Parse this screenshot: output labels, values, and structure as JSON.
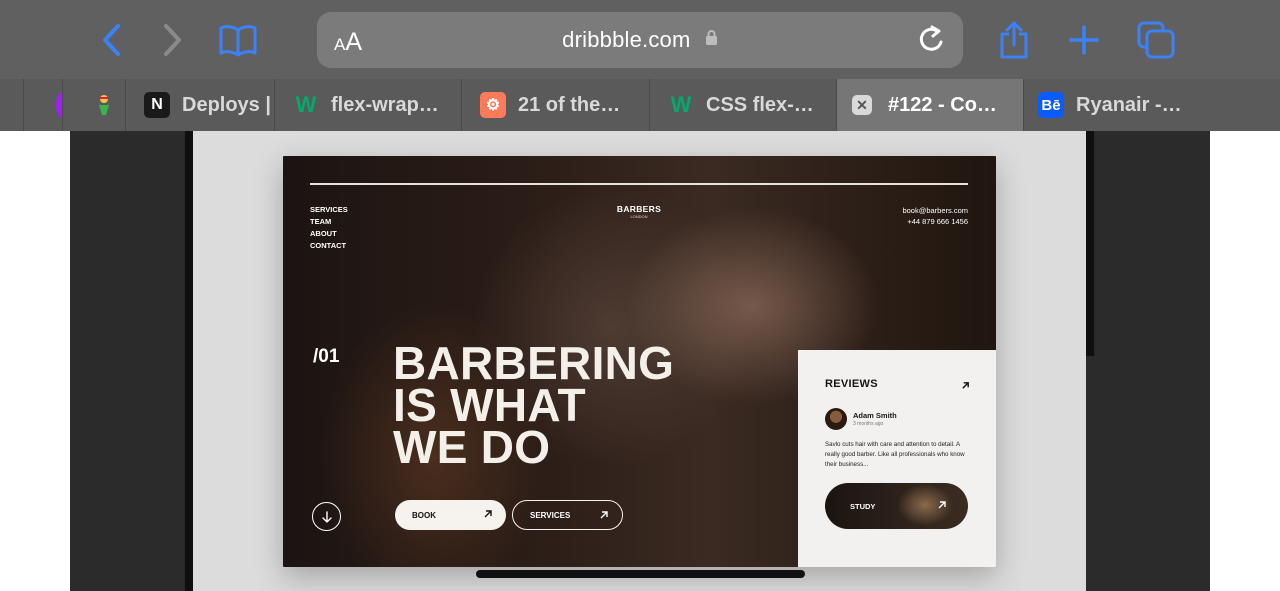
{
  "browser": {
    "address": {
      "aa_small": "A",
      "aa_large": "A",
      "url": "dribbble.com"
    }
  },
  "tabs": [
    {
      "label": "",
      "icon": "purple-circle-favicon",
      "color": "#a020f0"
    },
    {
      "label": "",
      "icon": "character-favicon",
      "color": "#3a3a3a"
    },
    {
      "label": "Deploys |",
      "icon": "notion-favicon",
      "favicon_text": "N",
      "color": "#ffffff"
    },
    {
      "label": "flex-wrap…",
      "icon": "w3schools-favicon",
      "favicon_text": "W",
      "color": "#04aa6d"
    },
    {
      "label": "21 of the…",
      "icon": "hubspot-favicon",
      "favicon_text": "⚙",
      "color": "#ff7a59"
    },
    {
      "label": "CSS flex-…",
      "icon": "w3schools-favicon",
      "favicon_text": "W",
      "color": "#04aa6d"
    },
    {
      "label": "#122 - Co…",
      "icon": "close-square-favicon",
      "favicon_text": "✕",
      "color": "#e0e0e0"
    },
    {
      "label": "Ryanair -…",
      "icon": "behance-favicon",
      "favicon_text": "Bē",
      "color": "#0b5cff"
    }
  ],
  "shot": {
    "nav": [
      "SERVICES",
      "TEAM",
      "ABOUT",
      "CONTACT"
    ],
    "logo_title": "BARBERS",
    "logo_sub": "LONDON",
    "email": "book@barbers.com",
    "phone": "+44 879 666 1456",
    "index": "/01",
    "hero_lines": [
      "BARBERING",
      "IS WHAT",
      "WE DO"
    ],
    "book_label": "BOOK",
    "services_label": "SERVICES",
    "reviews": {
      "title": "REVIEWS",
      "name": "Adam Smith",
      "ago": "3 months ago",
      "text": "Savlo cuts hair with care and attention to detail. A really good barber. Like all professionals who know their business...",
      "study_label": "STUDY"
    }
  },
  "colors": {
    "accent": "#3b82f6",
    "toolbar": "#606060",
    "tabstrip": "#5a5a5a"
  }
}
